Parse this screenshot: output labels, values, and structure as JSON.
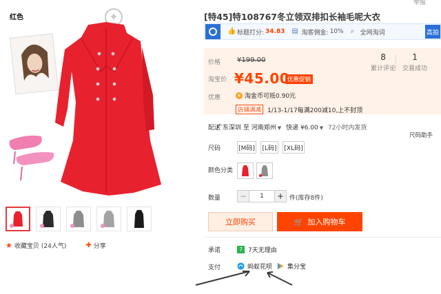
{
  "corner_text": "举报",
  "gallery": {
    "color_label": "红色",
    "fav_label": "收藏宝贝",
    "fav_count": "(24人气)",
    "share_label": "分享"
  },
  "product": {
    "title": "[特45]特108767冬立领双排扣长袖毛呢大衣"
  },
  "promo": {
    "rating_label": "标题打分:",
    "rating_value": "34.83",
    "commission_label": "淘客佣金:",
    "commission_value": "10%",
    "search_label": "全网淘词",
    "more_label": "高拍"
  },
  "price": {
    "price_label": "价格",
    "original_price": "¥199.00",
    "taobao_label": "淘宝价",
    "current_price": "¥45.00",
    "promo_tag": "优惠促销",
    "reviews_count": "8",
    "reviews_label": "累计评论",
    "sales_count": "1",
    "sales_label": "交易成功",
    "discount_label": "优惠",
    "coin_text": "淘金币可抵0.90元",
    "shop_tag": "店铺满减",
    "shop_text": "1/13-1/17每满200减10,上不封顶"
  },
  "shipping": {
    "label": "配送",
    "from": "广东深圳",
    "to_word": "至",
    "to": "河南郑州",
    "method": "快递",
    "fee": "¥6.00",
    "eta": "72小时内发货",
    "side_note": "尺码助手"
  },
  "options": {
    "size_label": "尺码",
    "sizes": [
      "[M码]",
      "[L码]",
      "[XL码]"
    ],
    "color_label": "颜色分类"
  },
  "quantity": {
    "label": "数量",
    "minus": "−",
    "value": "1",
    "plus": "+",
    "stock": "件(库存8件)"
  },
  "actions": {
    "buy_now": "立即购买",
    "add_cart": "加入购物车"
  },
  "service": {
    "pledge_label": "承诺",
    "pledge_text": "7天无理由",
    "pay_label": "支付",
    "pay_huabei": "蚂蚁花呗",
    "pay_jifenbao": "集分宝"
  }
}
